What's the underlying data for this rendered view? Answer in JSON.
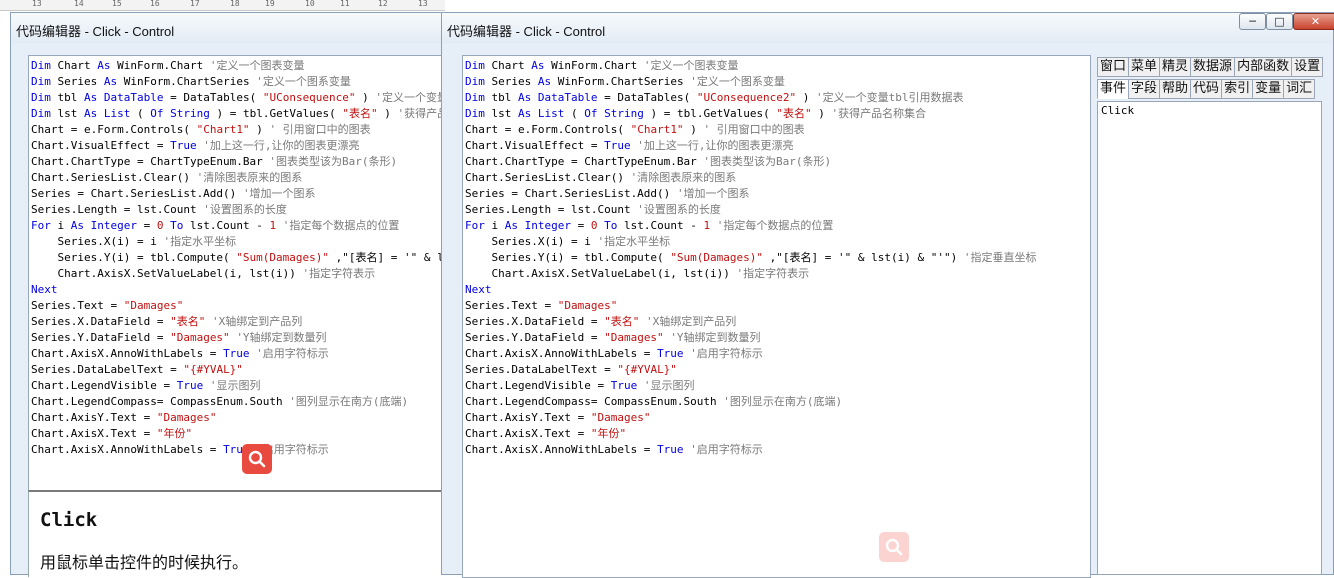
{
  "ruler": [
    "13",
    "14",
    "15",
    "16",
    "17",
    "18",
    "19",
    "10",
    "11",
    "12",
    "13"
  ],
  "left_window": {
    "title": "代码编辑器 - Click - Control"
  },
  "right_window": {
    "title": "代码编辑器 - Click - Control"
  },
  "controls": {
    "minimize": "─",
    "maximize": "□",
    "close": "✕"
  },
  "help": {
    "title": "Click",
    "description": "用鼠标单击控件的时候执行。"
  },
  "tabs_row1": [
    "窗口",
    "菜单",
    "精灵",
    "数据源",
    "内部函数",
    "设置"
  ],
  "tabs_row2": [
    "事件",
    "字段",
    "帮助",
    "代码",
    "索引",
    "变量",
    "词汇"
  ],
  "active_tab": "事件",
  "events": [
    "Click"
  ],
  "left_code": [
    [
      [
        "kw",
        "Dim"
      ],
      [
        "",
        "Chart"
      ],
      [
        "kw",
        "As"
      ],
      [
        "",
        "WinForm.Chart"
      ],
      [
        "cm",
        "'定义一个图表变量"
      ]
    ],
    [
      [
        "kw",
        "Dim"
      ],
      [
        "",
        "Series"
      ],
      [
        "kw",
        "As"
      ],
      [
        "",
        "WinForm.ChartSeries"
      ],
      [
        "cm",
        "'定义一个图系变量"
      ]
    ],
    [
      [
        "kw",
        "Dim"
      ],
      [
        "",
        "tbl"
      ],
      [
        "kw",
        "As"
      ],
      [
        "kw",
        "DataTable"
      ],
      [
        "",
        "= DataTables("
      ],
      [
        "st",
        "\"UConsequence\""
      ],
      [
        "",
        ")"
      ],
      [
        "cm",
        "'定义一个变量tbl引用"
      ]
    ],
    [
      [
        "kw",
        "Dim"
      ],
      [
        "",
        "lst"
      ],
      [
        "kw",
        "As"
      ],
      [
        "kw",
        "List"
      ],
      [
        "",
        "("
      ],
      [
        "kw",
        "Of"
      ],
      [
        "kw",
        "String"
      ],
      [
        "",
        ") = tbl.GetValues("
      ],
      [
        "st",
        "\"表名\""
      ],
      [
        "",
        ")"
      ],
      [
        "cm",
        "'获得产品名称集合"
      ]
    ],
    [
      [
        "",
        "Chart = e.Form.Controls("
      ],
      [
        "st",
        "\"Chart1\""
      ],
      [
        "",
        ")"
      ],
      [
        "cm",
        "' 引用窗口中的图表"
      ]
    ],
    [
      [
        "",
        "Chart.VisualEffect ="
      ],
      [
        "kw",
        "True"
      ],
      [
        "cm",
        "'加上这一行,让你的图表更漂亮"
      ]
    ],
    [
      [
        "",
        "Chart.ChartType = ChartTypeEnum.Bar"
      ],
      [
        "cm",
        "'图表类型该为Bar(条形)"
      ]
    ],
    [
      [
        "",
        "Chart.SeriesList.Clear()"
      ],
      [
        "cm",
        "'清除图表原来的图系"
      ]
    ],
    [
      [
        "",
        "Series = Chart.SeriesList.Add()"
      ],
      [
        "cm",
        "'增加一个图系"
      ]
    ],
    [
      [
        "",
        "Series.Length = lst.Count"
      ],
      [
        "cm",
        "'设置图系的长度"
      ]
    ],
    [
      [
        "kw",
        "For"
      ],
      [
        "",
        "i"
      ],
      [
        "kw",
        "As"
      ],
      [
        "kw",
        "Integer"
      ],
      [
        "",
        "="
      ],
      [
        "st",
        "0"
      ],
      [
        "kw",
        "To"
      ],
      [
        "",
        "lst.Count -"
      ],
      [
        "st",
        "1"
      ],
      [
        "cm",
        "'指定每个数据点的位置"
      ]
    ],
    [
      [
        "",
        "    Series.X(i) = i"
      ],
      [
        "cm",
        "'指定水平坐标"
      ]
    ],
    [
      [
        "",
        "    Series.Y(i) = tbl.Compute("
      ],
      [
        "st",
        "\"Sum(Damages)\""
      ],
      [
        "",
        ",\"[表名] = '\" & lst(i) & \"'\")"
      ],
      [
        "cm",
        "'指定垂直坐标"
      ]
    ],
    [
      [
        "",
        "    Chart.AxisX.SetValueLabel(i, lst(i))"
      ],
      [
        "cm",
        "'指定字符表示"
      ]
    ],
    [
      [
        "kw",
        "Next"
      ]
    ],
    [
      [
        "",
        "Series.Text ="
      ],
      [
        "st",
        "\"Damages\""
      ]
    ],
    [
      [
        "",
        "Series.X.DataField ="
      ],
      [
        "st",
        "\"表名\""
      ],
      [
        "cm",
        "'X轴绑定到产品列"
      ]
    ],
    [
      [
        "",
        "Series.Y.DataField ="
      ],
      [
        "st",
        "\"Damages\""
      ],
      [
        "cm",
        "'Y轴绑定到数量列"
      ]
    ],
    [
      [
        "",
        "Chart.AxisX.AnnoWithLabels ="
      ],
      [
        "kw",
        "True"
      ],
      [
        "cm",
        "'启用字符标示"
      ]
    ],
    [
      [
        "",
        "Series.DataLabelText ="
      ],
      [
        "st",
        "\"{#YVAL}\""
      ]
    ],
    [
      [
        "",
        "Chart.LegendVisible ="
      ],
      [
        "kw",
        "True"
      ],
      [
        "cm",
        "'显示图列"
      ]
    ],
    [
      [
        "",
        "Chart.LegendCompass= CompassEnum.South"
      ],
      [
        "cm",
        "'图列显示在南方(底端)"
      ]
    ],
    [
      [
        "",
        "Chart.AxisY.Text ="
      ],
      [
        "st",
        "\"Damages\""
      ]
    ],
    [
      [
        "",
        "Chart.AxisX.Text ="
      ],
      [
        "st",
        "\"年份\""
      ]
    ],
    [
      [
        "",
        "Chart.AxisX.AnnoWithLabels ="
      ],
      [
        "kw",
        "True"
      ],
      [
        "cm",
        "'启用字符标示"
      ]
    ]
  ],
  "right_code": [
    [
      [
        "kw",
        "Dim"
      ],
      [
        "",
        "Chart"
      ],
      [
        "kw",
        "As"
      ],
      [
        "",
        "WinForm.Chart"
      ],
      [
        "cm",
        "'定义一个图表变量"
      ]
    ],
    [
      [
        "kw",
        "Dim"
      ],
      [
        "",
        "Series"
      ],
      [
        "kw",
        "As"
      ],
      [
        "",
        "WinForm.ChartSeries"
      ],
      [
        "cm",
        "'定义一个图系变量"
      ]
    ],
    [
      [
        "kw",
        "Dim"
      ],
      [
        "",
        "tbl"
      ],
      [
        "kw",
        "As"
      ],
      [
        "kw",
        "DataTable"
      ],
      [
        "",
        "= DataTables("
      ],
      [
        "st",
        "\"UConsequence2\""
      ],
      [
        "",
        ")"
      ],
      [
        "cm",
        "'定义一个变量tbl引用数据表"
      ]
    ],
    [
      [
        "kw",
        "Dim"
      ],
      [
        "",
        "lst"
      ],
      [
        "kw",
        "As"
      ],
      [
        "kw",
        "List"
      ],
      [
        "",
        "("
      ],
      [
        "kw",
        "Of"
      ],
      [
        "kw",
        "String"
      ],
      [
        "",
        ") = tbl.GetValues("
      ],
      [
        "st",
        "\"表名\""
      ],
      [
        "",
        ")"
      ],
      [
        "cm",
        "'获得产品名称集合"
      ]
    ],
    [
      [
        "",
        "Chart = e.Form.Controls("
      ],
      [
        "st",
        "\"Chart1\""
      ],
      [
        "",
        ")"
      ],
      [
        "cm",
        "' 引用窗口中的图表"
      ]
    ],
    [
      [
        "",
        "Chart.VisualEffect ="
      ],
      [
        "kw",
        "True"
      ],
      [
        "cm",
        "'加上这一行,让你的图表更漂亮"
      ]
    ],
    [
      [
        "",
        "Chart.ChartType = ChartTypeEnum.Bar"
      ],
      [
        "cm",
        "'图表类型该为Bar(条形)"
      ]
    ],
    [
      [
        "",
        "Chart.SeriesList.Clear()"
      ],
      [
        "cm",
        "'清除图表原来的图系"
      ]
    ],
    [
      [
        "",
        "Series = Chart.SeriesList.Add()"
      ],
      [
        "cm",
        "'增加一个图系"
      ]
    ],
    [
      [
        "",
        "Series.Length = lst.Count"
      ],
      [
        "cm",
        "'设置图系的长度"
      ]
    ],
    [
      [
        "kw",
        "For"
      ],
      [
        "",
        "i"
      ],
      [
        "kw",
        "As"
      ],
      [
        "kw",
        "Integer"
      ],
      [
        "",
        "="
      ],
      [
        "st",
        "0"
      ],
      [
        "kw",
        "To"
      ],
      [
        "",
        "lst.Count -"
      ],
      [
        "st",
        "1"
      ],
      [
        "cm",
        "'指定每个数据点的位置"
      ]
    ],
    [
      [
        "",
        "    Series.X(i) = i"
      ],
      [
        "cm",
        "'指定水平坐标"
      ]
    ],
    [
      [
        "",
        "    Series.Y(i) = tbl.Compute("
      ],
      [
        "st",
        "\"Sum(Damages)\""
      ],
      [
        "",
        ",\"[表名] = '\" & lst(i) & \"'\")"
      ],
      [
        "cm",
        "'指定垂直坐标"
      ]
    ],
    [
      [
        "",
        "    Chart.AxisX.SetValueLabel(i, lst(i))"
      ],
      [
        "cm",
        "'指定字符表示"
      ]
    ],
    [
      [
        "kw",
        "Next"
      ]
    ],
    [
      [
        "",
        "Series.Text ="
      ],
      [
        "st",
        "\"Damages\""
      ]
    ],
    [
      [
        "",
        "Series.X.DataField ="
      ],
      [
        "st",
        "\"表名\""
      ],
      [
        "cm",
        "'X轴绑定到产品列"
      ]
    ],
    [
      [
        "",
        "Series.Y.DataField ="
      ],
      [
        "st",
        "\"Damages\""
      ],
      [
        "cm",
        "'Y轴绑定到数量列"
      ]
    ],
    [
      [
        "",
        "Chart.AxisX.AnnoWithLabels ="
      ],
      [
        "kw",
        "True"
      ],
      [
        "cm",
        "'启用字符标示"
      ]
    ],
    [
      [
        "",
        "Series.DataLabelText ="
      ],
      [
        "st",
        "\"{#YVAL}\""
      ]
    ],
    [
      [
        "",
        "Chart.LegendVisible ="
      ],
      [
        "kw",
        "True"
      ],
      [
        "cm",
        "'显示图列"
      ]
    ],
    [
      [
        "",
        "Chart.LegendCompass= CompassEnum.South"
      ],
      [
        "cm",
        "'图列显示在南方(底端)"
      ]
    ],
    [
      [
        "",
        "Chart.AxisY.Text ="
      ],
      [
        "st",
        "\"Damages\""
      ]
    ],
    [
      [
        "",
        "Chart.AxisX.Text ="
      ],
      [
        "st",
        "\"年份\""
      ]
    ],
    [
      [
        "",
        "Chart.AxisX.AnnoWithLabels ="
      ],
      [
        "kw",
        "True"
      ],
      [
        "cm",
        "'启用字符标示"
      ]
    ]
  ]
}
